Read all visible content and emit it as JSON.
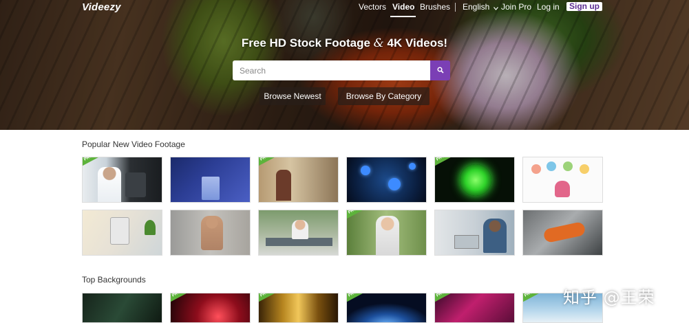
{
  "header": {
    "logo": "Videezy",
    "nav": [
      {
        "label": "Vectors",
        "active": false
      },
      {
        "label": "Video",
        "active": true
      },
      {
        "label": "Brushes",
        "active": false
      },
      {
        "label": "English",
        "active": false,
        "icon": "chevron-down-icon"
      },
      {
        "label": "Join Pro",
        "active": false
      },
      {
        "label": "Log in",
        "active": false
      }
    ],
    "signup_label": "Sign up",
    "accent": "#7b3fb5"
  },
  "hero": {
    "headline_part1": "Free HD Stock Footage",
    "headline_amp": "&",
    "headline_part2": "4K Videos!",
    "search_placeholder": "Search",
    "browse_newest": "Browse Newest",
    "browse_category": "Browse By Category"
  },
  "sections": [
    {
      "title": "Popular New Video Footage",
      "thumbnails": [
        {
          "subject": "lab-scientist-microscope",
          "pro": true,
          "pro_label": "PRO"
        },
        {
          "subject": "lab-glass-liquid",
          "pro": false
        },
        {
          "subject": "workshop-worker",
          "pro": true,
          "pro_label": "PRO"
        },
        {
          "subject": "blue-virus-cells",
          "pro": false
        },
        {
          "subject": "green-glowing-virus",
          "pro": true,
          "pro_label": "PRO"
        },
        {
          "subject": "flat-illustration-icons",
          "pro": false
        },
        {
          "subject": "lab-microscope-hand",
          "pro": false
        },
        {
          "subject": "man-on-sofa-phone",
          "pro": false
        },
        {
          "subject": "office-desk-woman",
          "pro": false
        },
        {
          "subject": "woman-mask-thumbs-up",
          "pro": true,
          "pro_label": "PRO"
        },
        {
          "subject": "stressed-man-laptop",
          "pro": false
        },
        {
          "subject": "cleaning-glove-surface",
          "pro": false
        }
      ]
    },
    {
      "title": "Top Backgrounds",
      "thumbnails": [
        {
          "subject": "circuit-board",
          "pro": false
        },
        {
          "subject": "red-particles",
          "pro": true,
          "pro_label": "PRO"
        },
        {
          "subject": "gold-light-streaks",
          "pro": true,
          "pro_label": "PRO"
        },
        {
          "subject": "planet-earth-glow",
          "pro": true,
          "pro_label": "PRO"
        },
        {
          "subject": "pink-abstract-waves",
          "pro": true,
          "pro_label": "PRO"
        },
        {
          "subject": "light-blue-sky",
          "pro": true,
          "pro_label": "PRO"
        }
      ]
    }
  ],
  "watermark": "知乎 @王荣"
}
